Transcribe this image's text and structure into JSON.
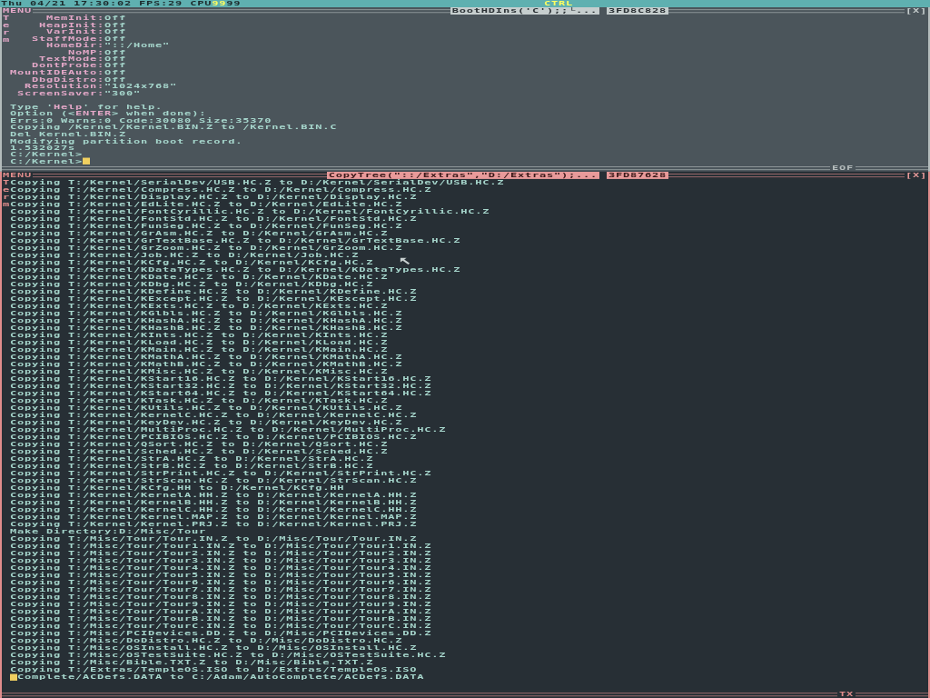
{
  "status_bar": {
    "clock": "Thu 04/21 17:30:02",
    "fps": "FPS:29",
    "cpu_label": "CPU",
    "cpu": [
      {
        "value": "99",
        "busy": true
      },
      {
        "value": "99",
        "busy": false
      }
    ],
    "mode": "CTRL"
  },
  "windows": [
    {
      "focused": false,
      "menu": "MENU",
      "side_label": "Term",
      "title": "BootHDIns('C');;└...",
      "id": "3FD8C828",
      "close": "[X]",
      "footer": "EOF",
      "settings": [
        {
          "label": "MemInit:",
          "value": "Off"
        },
        {
          "label": "HeapInit:",
          "value": "Off"
        },
        {
          "label": "VarInit:",
          "value": "Off"
        },
        {
          "label": "StaffMode:",
          "value": "Off"
        },
        {
          "label": "HomeDir:",
          "value": "\"::/Home\""
        },
        {
          "label": "NoMP:",
          "value": "Off"
        },
        {
          "label": "TextMode:",
          "value": "Off"
        },
        {
          "label": "DontProbe:",
          "value": "Off"
        },
        {
          "label": "MountIDEAuto:",
          "value": "Off"
        },
        {
          "label": "DbgDistro:",
          "value": "Off"
        },
        {
          "label": "Resolution:",
          "value": "\"1024x768\""
        },
        {
          "label": "ScreenSaver:",
          "value": "\"300\""
        }
      ],
      "lines": [
        [
          {
            "text": "Type '"
          },
          {
            "text": "Help",
            "kind": "link"
          },
          {
            "text": "' for help."
          }
        ],
        [
          {
            "text": "Option (<"
          },
          {
            "text": "ENTER",
            "kind": "link"
          },
          {
            "text": "> when done):"
          }
        ],
        [
          {
            "text": "Errs:0 Warns:0 Code:30080 Size:35370"
          }
        ],
        [
          {
            "text": "Copying /Kernel/Kernel.BIN.Z to /Kernel.BIN.C"
          }
        ],
        [
          {
            "text": "Del Kernel.BIN.Z"
          }
        ],
        [
          {
            "text": "Modifying partition boot record."
          }
        ],
        [
          {
            "text": "1.532027s"
          }
        ],
        [
          {
            "text": "C:/Kernel>"
          }
        ],
        [
          {
            "text": "C:/Kernel>"
          },
          {
            "kind": "cursor"
          }
        ]
      ]
    },
    {
      "focused": true,
      "menu": "MENU",
      "side_label": "Term",
      "title": "CopyTree(\"::/Extras\",\"D:/Extras\");...",
      "id": "3FD87628",
      "close": "[X]",
      "footer": "TX",
      "lines": [
        [
          {
            "text": "Copying T:/Kernel/SerialDev/USB.HC.Z to D:/Kernel/SerialDev/USB.HC.Z"
          }
        ],
        [
          {
            "text": "Copying T:/Kernel/Compress.HC.Z to D:/Kernel/Compress.HC.Z"
          }
        ],
        [
          {
            "text": "Copying T:/Kernel/Display.HC.Z to D:/Kernel/Display.HC.Z"
          }
        ],
        [
          {
            "text": "Copying T:/Kernel/EdLite.HC.Z to D:/Kernel/EdLite.HC.Z"
          }
        ],
        [
          {
            "text": "Copying T:/Kernel/FontCyrillic.HC.Z to D:/Kernel/FontCyrillic.HC.Z"
          }
        ],
        [
          {
            "text": "Copying T:/Kernel/FontStd.HC.Z to D:/Kernel/FontStd.HC.Z"
          }
        ],
        [
          {
            "text": "Copying T:/Kernel/FunSeg.HC.Z to D:/Kernel/FunSeg.HC.Z"
          }
        ],
        [
          {
            "text": "Copying T:/Kernel/GrAsm.HC.Z to D:/Kernel/GrAsm.HC.Z"
          }
        ],
        [
          {
            "text": "Copying T:/Kernel/GrTextBase.HC.Z to D:/Kernel/GrTextBase.HC.Z"
          }
        ],
        [
          {
            "text": "Copying T:/Kernel/GrZoom.HC.Z to D:/Kernel/GrZoom.HC.Z"
          }
        ],
        [
          {
            "text": "Copying T:/Kernel/Job.HC.Z to D:/Kernel/Job.HC.Z"
          }
        ],
        [
          {
            "text": "Copying T:/Kernel/KCfg.HC.Z to D:/Kernel/KCfg.HC.Z"
          }
        ],
        [
          {
            "text": "Copying T:/Kernel/KDataTypes.HC.Z to D:/Kernel/KDataTypes.HC.Z"
          }
        ],
        [
          {
            "text": "Copying T:/Kernel/KDate.HC.Z to D:/Kernel/KDate.HC.Z"
          }
        ],
        [
          {
            "text": "Copying T:/Kernel/KDbg.HC.Z to D:/Kernel/KDbg.HC.Z"
          }
        ],
        [
          {
            "text": "Copying T:/Kernel/KDefine.HC.Z to D:/Kernel/KDefine.HC.Z"
          }
        ],
        [
          {
            "text": "Copying T:/Kernel/KExcept.HC.Z to D:/Kernel/KExcept.HC.Z"
          }
        ],
        [
          {
            "text": "Copying T:/Kernel/KExts.HC.Z to D:/Kernel/KExts.HC.Z"
          }
        ],
        [
          {
            "text": "Copying T:/Kernel/KGlbls.HC.Z to D:/Kernel/KGlbls.HC.Z"
          }
        ],
        [
          {
            "text": "Copying T:/Kernel/KHashA.HC.Z to D:/Kernel/KHashA.HC.Z"
          }
        ],
        [
          {
            "text": "Copying T:/Kernel/KHashB.HC.Z to D:/Kernel/KHashB.HC.Z"
          }
        ],
        [
          {
            "text": "Copying T:/Kernel/KInts.HC.Z to D:/Kernel/KInts.HC.Z"
          }
        ],
        [
          {
            "text": "Copying T:/Kernel/KLoad.HC.Z to D:/Kernel/KLoad.HC.Z"
          }
        ],
        [
          {
            "text": "Copying T:/Kernel/KMain.HC.Z to D:/Kernel/KMain.HC.Z"
          }
        ],
        [
          {
            "text": "Copying T:/Kernel/KMathA.HC.Z to D:/Kernel/KMathA.HC.Z"
          }
        ],
        [
          {
            "text": "Copying T:/Kernel/KMathB.HC.Z to D:/Kernel/KMathB.HC.Z"
          }
        ],
        [
          {
            "text": "Copying T:/Kernel/KMisc.HC.Z to D:/Kernel/KMisc.HC.Z"
          }
        ],
        [
          {
            "text": "Copying T:/Kernel/KStart16.HC.Z to D:/Kernel/KStart16.HC.Z"
          }
        ],
        [
          {
            "text": "Copying T:/Kernel/KStart32.HC.Z to D:/Kernel/KStart32.HC.Z"
          }
        ],
        [
          {
            "text": "Copying T:/Kernel/KStart64.HC.Z to D:/Kernel/KStart64.HC.Z"
          }
        ],
        [
          {
            "text": "Copying T:/Kernel/KTask.HC.Z to D:/Kernel/KTask.HC.Z"
          }
        ],
        [
          {
            "text": "Copying T:/Kernel/KUtils.HC.Z to D:/Kernel/KUtils.HC.Z"
          }
        ],
        [
          {
            "text": "Copying T:/Kernel/KernelC.HC.Z to D:/Kernel/KernelC.HC.Z"
          }
        ],
        [
          {
            "text": "Copying T:/Kernel/KeyDev.HC.Z to D:/Kernel/KeyDev.HC.Z"
          }
        ],
        [
          {
            "text": "Copying T:/Kernel/MultiProc.HC.Z to D:/Kernel/MultiProc.HC.Z"
          }
        ],
        [
          {
            "text": "Copying T:/Kernel/PCIBIOS.HC.Z to D:/Kernel/PCIBIOS.HC.Z"
          }
        ],
        [
          {
            "text": "Copying T:/Kernel/QSort.HC.Z to D:/Kernel/QSort.HC.Z"
          }
        ],
        [
          {
            "text": "Copying T:/Kernel/Sched.HC.Z to D:/Kernel/Sched.HC.Z"
          }
        ],
        [
          {
            "text": "Copying T:/Kernel/StrA.HC.Z to D:/Kernel/StrA.HC.Z"
          }
        ],
        [
          {
            "text": "Copying T:/Kernel/StrB.HC.Z to D:/Kernel/StrB.HC.Z"
          }
        ],
        [
          {
            "text": "Copying T:/Kernel/StrPrint.HC.Z to D:/Kernel/StrPrint.HC.Z"
          }
        ],
        [
          {
            "text": "Copying T:/Kernel/StrScan.HC.Z to D:/Kernel/StrScan.HC.Z"
          }
        ],
        [
          {
            "text": "Copying T:/Kernel/KCfg.HH to D:/Kernel/KCfg.HH"
          }
        ],
        [
          {
            "text": "Copying T:/Kernel/KernelA.HH.Z to D:/Kernel/KernelA.HH.Z"
          }
        ],
        [
          {
            "text": "Copying T:/Kernel/KernelB.HH.Z to D:/Kernel/KernelB.HH.Z"
          }
        ],
        [
          {
            "text": "Copying T:/Kernel/KernelC.HH.Z to D:/Kernel/KernelC.HH.Z"
          }
        ],
        [
          {
            "text": "Copying T:/Kernel/Kernel.MAP.Z to D:/Kernel/Kernel.MAP.Z"
          }
        ],
        [
          {
            "text": "Copying T:/Kernel/Kernel.PRJ.Z to D:/Kernel/Kernel.PRJ.Z"
          }
        ],
        [
          {
            "text": "Make Directory:D:/Misc/Tour"
          }
        ],
        [
          {
            "text": "Copying T:/Misc/Tour/Tour.IN.Z to D:/Misc/Tour/Tour.IN.Z"
          }
        ],
        [
          {
            "text": "Copying T:/Misc/Tour/Tour1.IN.Z to D:/Misc/Tour/Tour1.IN.Z"
          }
        ],
        [
          {
            "text": "Copying T:/Misc/Tour/Tour2.IN.Z to D:/Misc/Tour/Tour2.IN.Z"
          }
        ],
        [
          {
            "text": "Copying T:/Misc/Tour/Tour3.IN.Z to D:/Misc/Tour/Tour3.IN.Z"
          }
        ],
        [
          {
            "text": "Copying T:/Misc/Tour/Tour4.IN.Z to D:/Misc/Tour/Tour4.IN.Z"
          }
        ],
        [
          {
            "text": "Copying T:/Misc/Tour/Tour5.IN.Z to D:/Misc/Tour/Tour5.IN.Z"
          }
        ],
        [
          {
            "text": "Copying T:/Misc/Tour/Tour6.IN.Z to D:/Misc/Tour/Tour6.IN.Z"
          }
        ],
        [
          {
            "text": "Copying T:/Misc/Tour/Tour7.IN.Z to D:/Misc/Tour/Tour7.IN.Z"
          }
        ],
        [
          {
            "text": "Copying T:/Misc/Tour/Tour8.IN.Z to D:/Misc/Tour/Tour8.IN.Z"
          }
        ],
        [
          {
            "text": "Copying T:/Misc/Tour/Tour9.IN.Z to D:/Misc/Tour/Tour9.IN.Z"
          }
        ],
        [
          {
            "text": "Copying T:/Misc/Tour/TourA.IN.Z to D:/Misc/Tour/TourA.IN.Z"
          }
        ],
        [
          {
            "text": "Copying T:/Misc/Tour/TourB.IN.Z to D:/Misc/Tour/TourB.IN.Z"
          }
        ],
        [
          {
            "text": "Copying T:/Misc/Tour/TourC.IN.Z to D:/Misc/Tour/TourC.IN.Z"
          }
        ],
        [
          {
            "text": "Copying T:/Misc/PCIDevices.DD.Z to D:/Misc/PCIDevices.DD.Z"
          }
        ],
        [
          {
            "text": "Copying T:/Misc/DoDistro.HC.Z to D:/Misc/DoDistro.HC.Z"
          }
        ],
        [
          {
            "text": "Copying T:/Misc/OSInstall.HC.Z to D:/Misc/OSInstall.HC.Z"
          }
        ],
        [
          {
            "text": "Copying T:/Misc/OSTestSuite.HC.Z to D:/Misc/OSTestSuite.HC.Z"
          }
        ],
        [
          {
            "text": "Copying T:/Misc/Bible.TXT.Z to D:/Misc/Bible.TXT.Z"
          }
        ],
        [
          {
            "text": "Copying T:/Extras/TempleOS.ISO to D:/Extras/TempleOS.ISO"
          }
        ],
        [
          {
            "kind": "cursor"
          },
          {
            "text": "Complete/ACDefs.DATA to C:/Adam/AutoComplete/ACDefs.DATA"
          }
        ]
      ]
    }
  ]
}
